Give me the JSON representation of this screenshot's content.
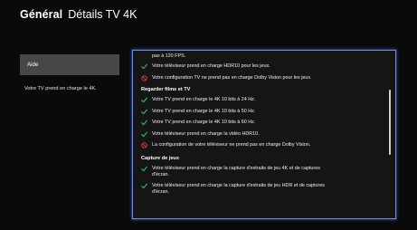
{
  "header": {
    "section": "Général",
    "title": "Détails TV 4K"
  },
  "sidebar": {
    "help_label": "Aide",
    "support_text": "Votre TV prend en charge le 4K."
  },
  "details": {
    "cut_line": "pas à 120 FPS.",
    "top_items": [
      {
        "status": "ok",
        "text": "Votre téléviseur prend en charge HDR10 pour les jeux."
      },
      {
        "status": "no",
        "text": "Votre configuration TV ne prend pas en charge Dolby Vision pour les jeux."
      }
    ],
    "movies_heading": "Regarder films et TV",
    "movies_items": [
      {
        "status": "ok",
        "text": "Votre TV prend en charge le 4K 10 bits à 24 Hz."
      },
      {
        "status": "ok",
        "text": "Votre TV prend en charge le 4K 10 bits à 50 Hz."
      },
      {
        "status": "ok",
        "text": "Votre TV prend en charge le 4K 10 bits à 60 Hz."
      },
      {
        "status": "ok",
        "text": "Votre téléviseur prend en charge la vidéo HDR10."
      },
      {
        "status": "no",
        "text": "La configuration de votre téléviseur ne prend pas en charge Dolby Vision."
      }
    ],
    "capture_heading": "Capture de jeux",
    "capture_items": [
      {
        "status": "ok",
        "line1": "Votre téléviseur prend en charge la capture d'extraits de jeu 4K et de captures",
        "line2": "d'écran."
      },
      {
        "status": "ok",
        "line1": "Votre téléviseur prend en charge la capture d'extraits de jeu HDR et de captures",
        "line2": "d'écran."
      }
    ]
  },
  "colors": {
    "ok": "#27c24c",
    "no": "#ef3b2f",
    "focus_border": "#6f8de0"
  },
  "icons": {
    "ok": "checkmark-icon",
    "no": "prohibited-icon"
  }
}
